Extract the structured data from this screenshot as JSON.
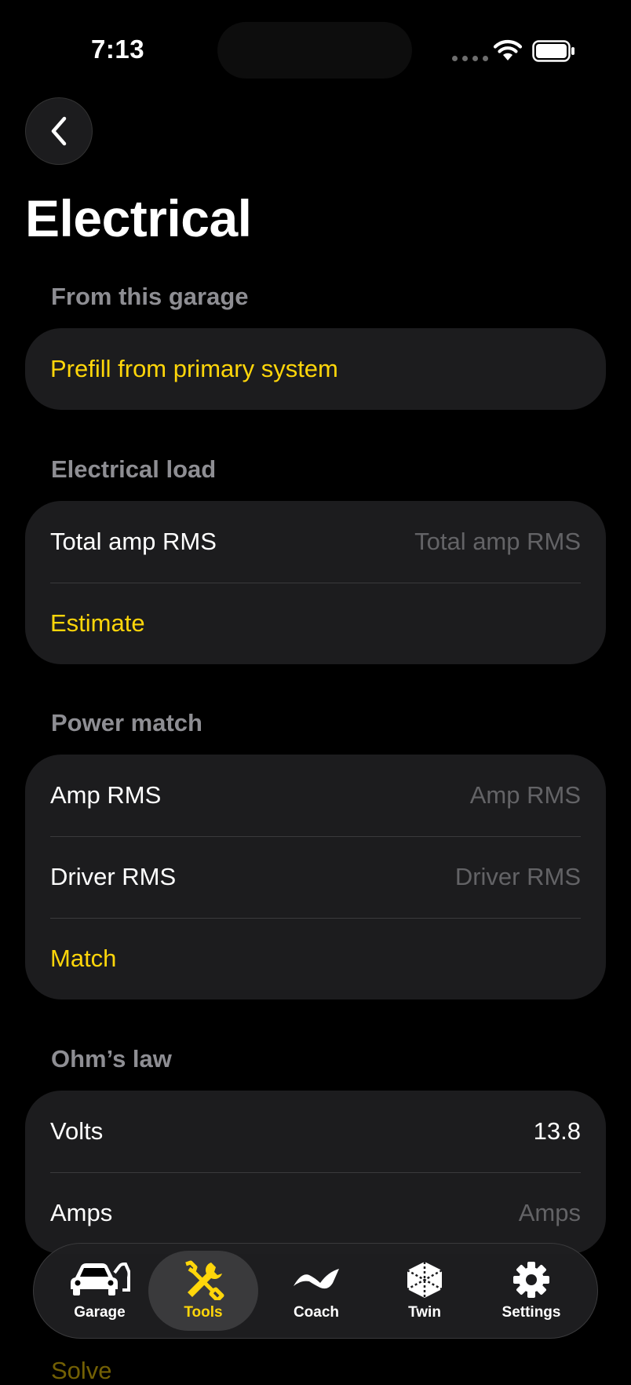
{
  "status": {
    "time": "7:13"
  },
  "page": {
    "title": "Electrical"
  },
  "sections": {
    "garage": {
      "header": "From this garage",
      "prefill_label": "Prefill from primary system"
    },
    "load": {
      "header": "Electrical load",
      "total_amp_label": "Total amp RMS",
      "total_amp_placeholder": "Total amp RMS",
      "estimate_label": "Estimate"
    },
    "power": {
      "header": "Power match",
      "amp_label": "Amp RMS",
      "amp_placeholder": "Amp RMS",
      "driver_label": "Driver RMS",
      "driver_placeholder": "Driver RMS",
      "match_label": "Match"
    },
    "ohms": {
      "header": "Ohm’s law",
      "volts_label": "Volts",
      "volts_value": "13.8",
      "amps_label": "Amps",
      "amps_placeholder": "Amps",
      "solve_label": "Solve"
    }
  },
  "tabs": [
    {
      "label": "Garage",
      "icon": "car-icon",
      "active": false
    },
    {
      "label": "Tools",
      "icon": "tools-icon",
      "active": true
    },
    {
      "label": "Coach",
      "icon": "waveform-icon",
      "active": false
    },
    {
      "label": "Twin",
      "icon": "cube-icon",
      "active": false
    },
    {
      "label": "Settings",
      "icon": "gear-icon",
      "active": false
    }
  ],
  "colors": {
    "accent": "#ffd60a",
    "background": "#000000",
    "card": "#1c1c1e",
    "secondary_text": "#8e8e93",
    "placeholder": "#636366"
  }
}
